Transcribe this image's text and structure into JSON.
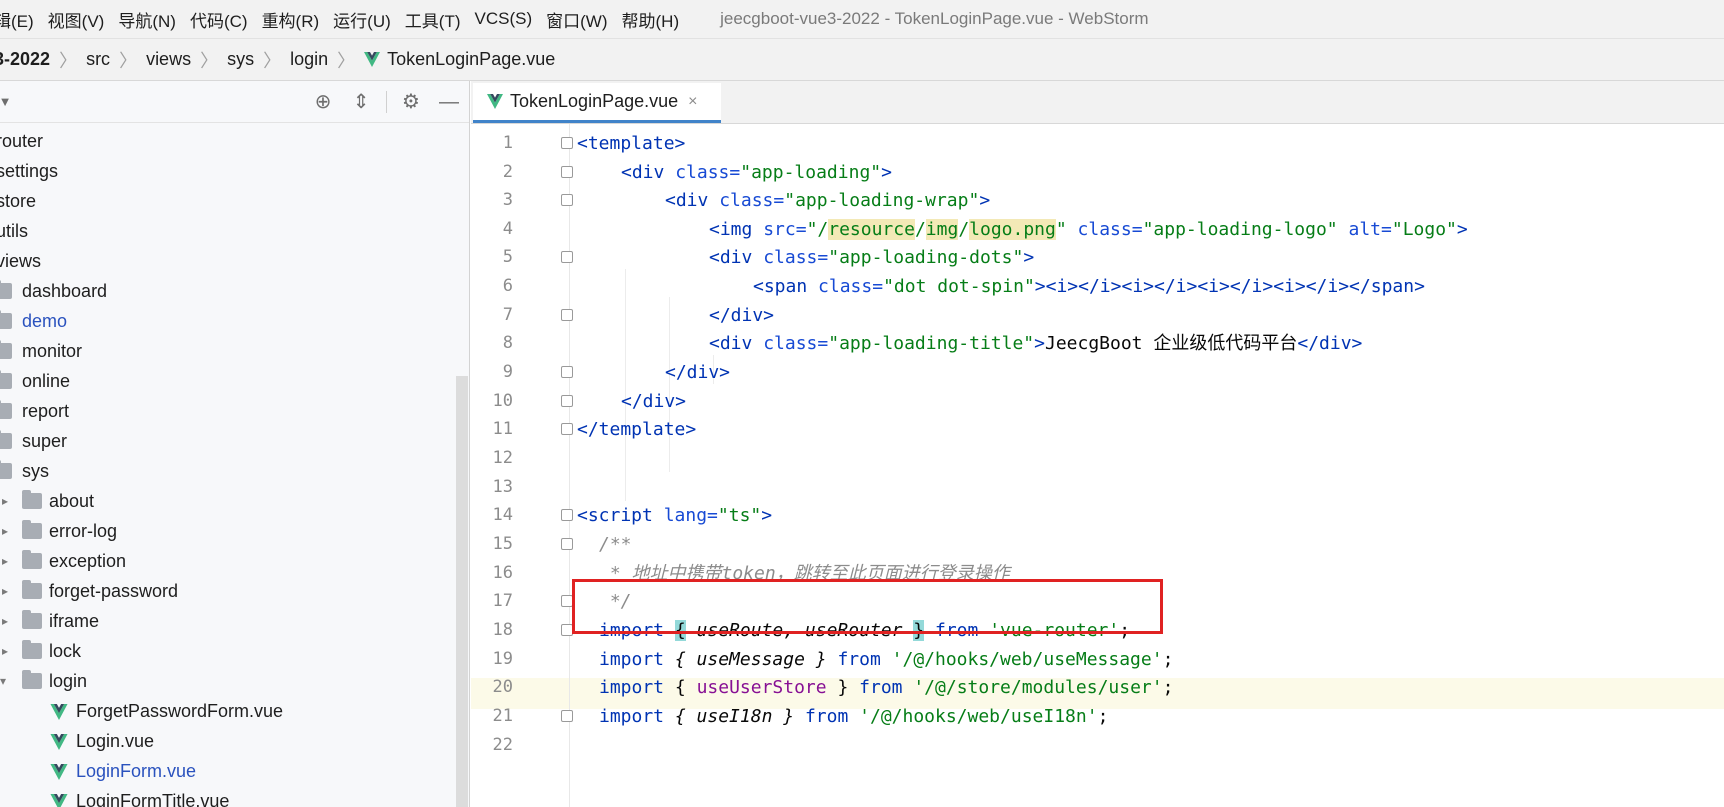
{
  "menubar": {
    "items": [
      "辑(E)",
      "视图(V)",
      "导航(N)",
      "代码(C)",
      "重构(R)",
      "运行(U)",
      "工具(T)",
      "VCS(S)",
      "窗口(W)",
      "帮助(H)"
    ],
    "window_title": "jeecgboot-vue3-2022 - TokenLoginPage.vue - WebStorm"
  },
  "breadcrumb": [
    "3-2022",
    "src",
    "views",
    "sys",
    "login",
    "TokenLoginPage.vue"
  ],
  "sidebar": {
    "items": [
      {
        "label": "router"
      },
      {
        "label": "settings"
      },
      {
        "label": "store"
      },
      {
        "label": "utils"
      },
      {
        "label": "views"
      },
      {
        "label": "dashboard"
      },
      {
        "label": "demo"
      },
      {
        "label": "monitor"
      },
      {
        "label": "online"
      },
      {
        "label": "report"
      },
      {
        "label": "super"
      },
      {
        "label": "sys"
      },
      {
        "label": "about"
      },
      {
        "label": "error-log"
      },
      {
        "label": "exception"
      },
      {
        "label": "forget-password"
      },
      {
        "label": "iframe"
      },
      {
        "label": "lock"
      },
      {
        "label": "login"
      },
      {
        "label": "ForgetPasswordForm.vue"
      },
      {
        "label": "Login.vue"
      },
      {
        "label": "LoginForm.vue"
      },
      {
        "label": "LoginFormTitle.vue"
      }
    ]
  },
  "editor": {
    "tab_label": "TokenLoginPage.vue",
    "tab_close": "×",
    "line_numbers": [
      "1",
      "2",
      "3",
      "4",
      "5",
      "6",
      "7",
      "8",
      "9",
      "10",
      "11",
      "12",
      "13",
      "14",
      "15",
      "16",
      "17",
      "18",
      "19",
      "20",
      "21",
      "22"
    ],
    "code": {
      "l1_tag": "<template>",
      "l2_open": "<div",
      "l2_attr": "class=",
      "l2_val": "\"app-loading\"",
      "l2_close": ">",
      "l3_open": "<div",
      "l3_attr": "class=",
      "l3_val": "\"app-loading-wrap\"",
      "l3_close": ">",
      "l4_open": "<img",
      "l4_attr1": "src=",
      "l4_v1a": "\"/",
      "l4_v1b": "resource",
      "l4_v1c": "/",
      "l4_v1d": "img",
      "l4_v1e": "/",
      "l4_v1f": "logo.png",
      "l4_v1g": "\"",
      "l4_attr2": "class=",
      "l4_v2": "\"app-loading-logo\"",
      "l4_attr3": "alt=",
      "l4_v3": "\"Logo\"",
      "l4_close": ">",
      "l5_open": "<div",
      "l5_attr": "class=",
      "l5_val": "\"app-loading-dots\"",
      "l5_close": ">",
      "l6_open": "<span",
      "l6_attr": "class=",
      "l6_val": "\"dot dot-spin\"",
      "l6_rest": "><i></i><i></i><i></i><i></i></span>",
      "l7": "</div>",
      "l8_open": "<div",
      "l8_attr": "class=",
      "l8_val": "\"app-loading-title\"",
      "l8_gt": ">",
      "l8_text": "JeecgBoot 企业级低代码平台",
      "l8_close": "</div>",
      "l9": "</div>",
      "l10": "</div>",
      "l11": "</template>",
      "l14_open": "<script",
      "l14_attr": "lang=",
      "l14_val": "\"ts\"",
      "l14_close": ">",
      "l15": "/**",
      "l16": " * 地址中携带token，跳转至此页面进行登录操作",
      "l17": " */",
      "l18_import": "import",
      "l18_lb": "{",
      "l18_names": " useRoute, useRouter ",
      "l18_rb": "}",
      "l18_from": "from",
      "l18_path": "'vue-router'",
      "l18_semi": ";",
      "l19_import": "import",
      "l19_names": "{ useMessage }",
      "l19_from": "from",
      "l19_path": "'/@/hooks/web/useMessage'",
      "l19_semi": ";",
      "l20_import": "import",
      "l20_lb": "{ ",
      "l20_name": "useUserStore",
      "l20_rb": " }",
      "l20_from": "from",
      "l20_path": "'/@/store/modules/user'",
      "l20_semi": ";",
      "l21_import": "import",
      "l21_names": "{ useI18n }",
      "l21_from": "from",
      "l21_path": "'/@/hooks/web/useI18n'",
      "l21_semi": ";"
    }
  },
  "colors": {
    "tag": "#0033b3",
    "attr": "#174ad4",
    "string": "#067d17",
    "comment": "#8c8c8c",
    "highlight_box": "#e02222",
    "vue_green": "#41b883"
  }
}
